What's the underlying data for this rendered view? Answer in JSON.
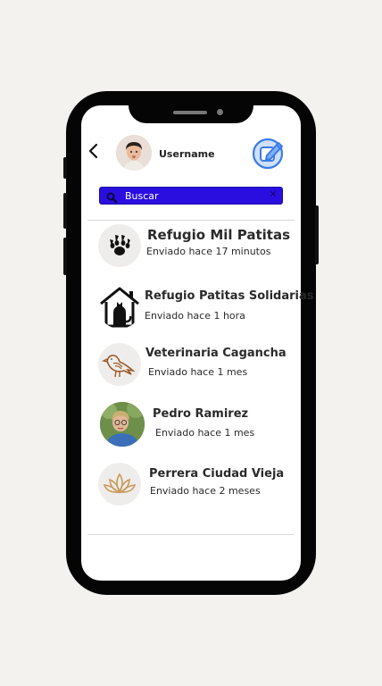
{
  "header": {
    "username": "Username"
  },
  "search": {
    "placeholder": "Buscar",
    "clear_label": "×"
  },
  "chats": [
    {
      "name": "Refugio Mil Patitas",
      "subtitle": "Enviado hace 17 minutos",
      "icon": "paw-icon"
    },
    {
      "name": "Refugio Patitas Solidarias",
      "subtitle": "Enviado hace 1 hora",
      "icon": "house-cat-icon"
    },
    {
      "name": "Veterinaria Cagancha",
      "subtitle": "Enviado hace 1 mes",
      "icon": "bird-icon"
    },
    {
      "name": "Pedro Ramirez",
      "subtitle": "Enviado hace 1 mes",
      "icon": "avatar-photo"
    },
    {
      "name": "Perrera Ciudad Vieja",
      "subtitle": "Enviado hace 2 meses",
      "icon": "lotus-icon"
    }
  ],
  "colors": {
    "search_bg": "#2a0ee0",
    "compose_accent": "#3b7be8",
    "background": "#f3f2ef"
  }
}
